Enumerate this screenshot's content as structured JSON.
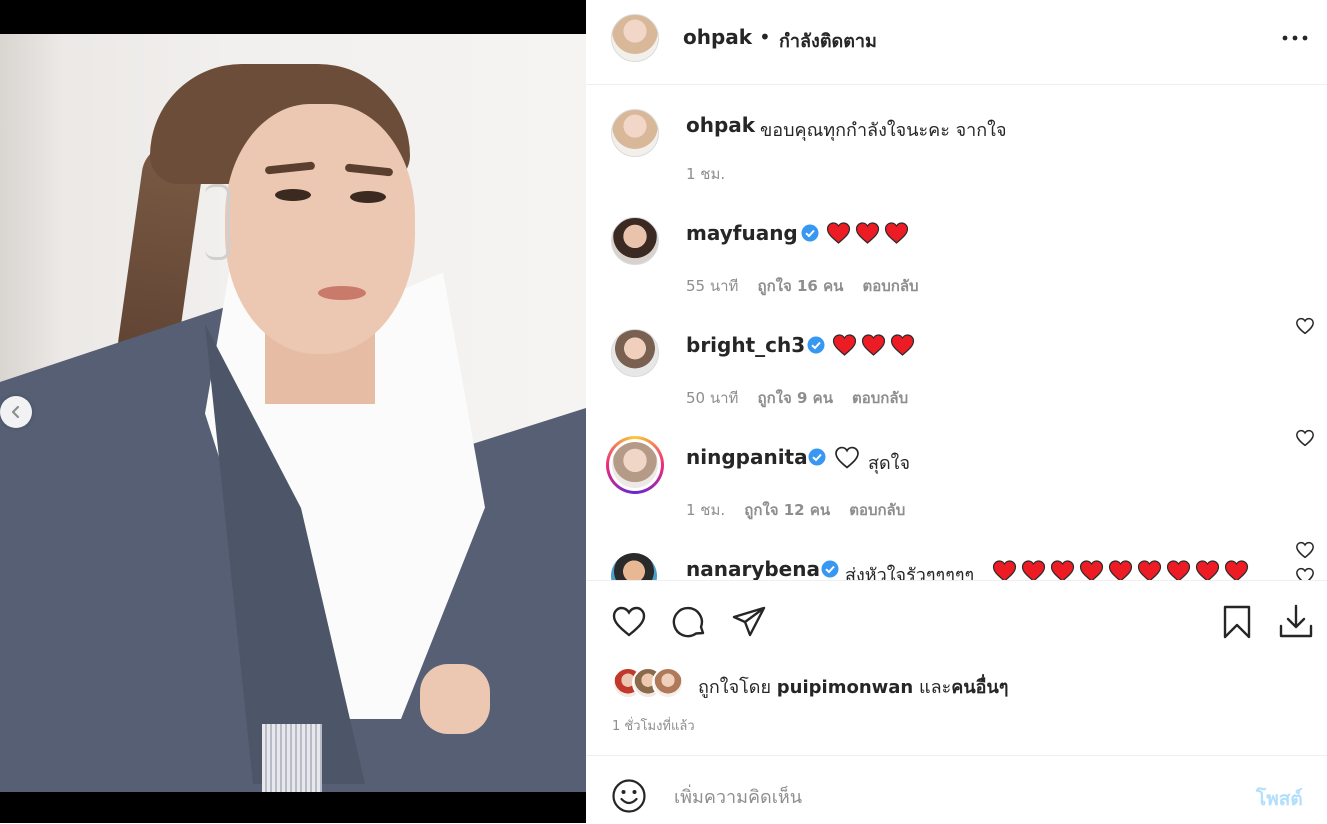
{
  "post": {
    "username": "ohpak",
    "separator": "•",
    "follow_status": "กำลังติดตาม",
    "caption_user": "ohpak",
    "caption": "ขอบคุณทุกกำลังใจนะคะ จากใจ",
    "caption_time": "1 ชม."
  },
  "comments": [
    {
      "user": "mayfuang",
      "verified": true,
      "text": "",
      "hearts": 3,
      "time": "55 นาที",
      "likes": "ถูกใจ 16 คน",
      "reply": "ตอบกลับ"
    },
    {
      "user": "bright_ch3",
      "verified": true,
      "text": "",
      "hearts": 3,
      "time": "50 นาที",
      "likes": "ถูกใจ 9 คน",
      "reply": "ตอบกลับ"
    },
    {
      "user": "ningpanita",
      "verified": true,
      "text": "สุดใจ",
      "hearts": 0,
      "time": "1 ชม.",
      "likes": "ถูกใจ 12 คน",
      "reply": "ตอบกลับ"
    },
    {
      "user": "nanarybena",
      "verified": true,
      "text": "ส่งหัวใจรัวๆๆๆๆๆ",
      "hearts": 9,
      "time": "",
      "likes": "",
      "reply": ""
    }
  ],
  "liked_by": {
    "prefix": "ถูกใจโดย",
    "user": "puipimonwan",
    "joiner": "และ",
    "others": "คนอื่นๆ"
  },
  "posted_ago": "1 ชั่วโมงที่แล้ว",
  "composer": {
    "placeholder": "เพิ่มความคิดเห็น",
    "post_label": "โพสต์"
  },
  "colors": {
    "verified": "#3897f0",
    "heart": "#ed4956",
    "post_disabled": "#b2dffc",
    "muted": "#8e8e8e"
  },
  "icons": [
    "chevron-left-icon",
    "more-icon",
    "verified-icon",
    "heart-icon",
    "comment-icon",
    "share-icon",
    "bookmark-icon",
    "download-icon",
    "emoji-icon"
  ]
}
